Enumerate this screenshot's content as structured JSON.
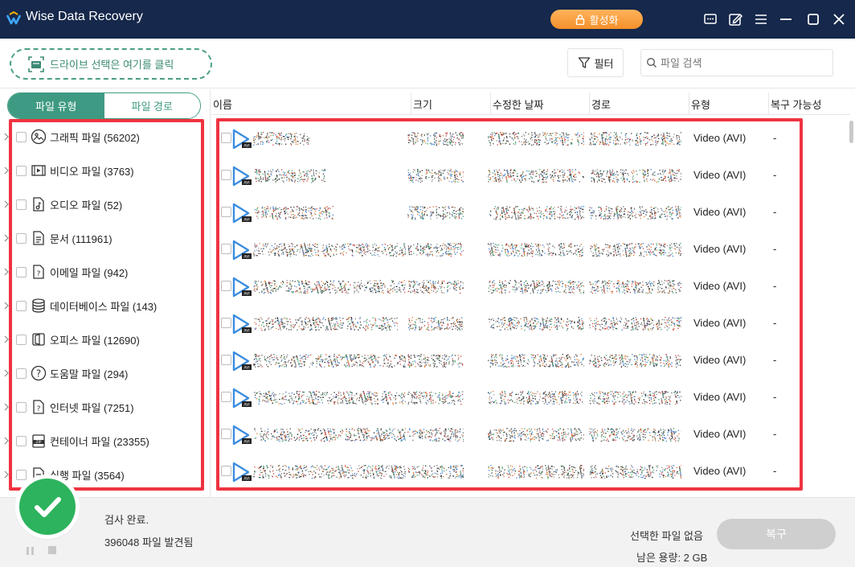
{
  "app": {
    "title": "Wise Data Recovery",
    "activate_label": "활성화"
  },
  "toolbar": {
    "drive_select_label": "드라이브 선택은 여기를 클릭",
    "filter_label": "필터",
    "search_placeholder": "파일 검색"
  },
  "sidebar": {
    "tabs": [
      {
        "label": "파일 유형"
      },
      {
        "label": "파일 경로"
      }
    ],
    "items": [
      {
        "label": "그래픽 파일 (56202)",
        "icon": "image-file-icon"
      },
      {
        "label": "비디오 파일 (3763)",
        "icon": "video-file-icon"
      },
      {
        "label": "오디오 파일 (52)",
        "icon": "audio-file-icon"
      },
      {
        "label": "문서 (111961)",
        "icon": "document-file-icon"
      },
      {
        "label": "이메일 파일 (942)",
        "icon": "email-file-icon"
      },
      {
        "label": "데이터베이스 파일 (143)",
        "icon": "database-icon"
      },
      {
        "label": "오피스 파일 (12690)",
        "icon": "office-file-icon"
      },
      {
        "label": "도움말 파일 (294)",
        "icon": "help-file-icon"
      },
      {
        "label": "인터넷 파일 (7251)",
        "icon": "internet-file-icon"
      },
      {
        "label": "컨테이너 파일 (23355)",
        "icon": "zip-file-icon"
      },
      {
        "label": "실행 파일 (3564)",
        "icon": "executable-file-icon"
      }
    ]
  },
  "table": {
    "columns": [
      "이름",
      "크기",
      "수정한 날짜",
      "경로",
      "유형",
      "복구 가능성"
    ],
    "rows": [
      {
        "type": "Video (AVI)",
        "recoverability": "-"
      },
      {
        "type": "Video (AVI)",
        "recoverability": "-"
      },
      {
        "type": "Video (AVI)",
        "recoverability": "-"
      },
      {
        "type": "Video (AVI)",
        "recoverability": "-"
      },
      {
        "type": "Video (AVI)",
        "recoverability": "-"
      },
      {
        "type": "Video (AVI)",
        "recoverability": "-"
      },
      {
        "type": "Video (AVI)",
        "recoverability": "-"
      },
      {
        "type": "Video (AVI)",
        "recoverability": "-"
      },
      {
        "type": "Video (AVI)",
        "recoverability": "-"
      },
      {
        "type": "Video (AVI)",
        "recoverability": "-"
      }
    ]
  },
  "status": {
    "scan_status": "검사 완료.",
    "files_found": "396048 파일 발견됨",
    "selected_files": "선택한 파일 없음",
    "free_space": "남은 용량: 2 GB",
    "recover_label": "복구"
  },
  "colors": {
    "titlebar": "#16284b",
    "accent": "#3e9a82",
    "activate": "#f4902a",
    "highlight": "#ef3340",
    "success": "#2db35d"
  }
}
